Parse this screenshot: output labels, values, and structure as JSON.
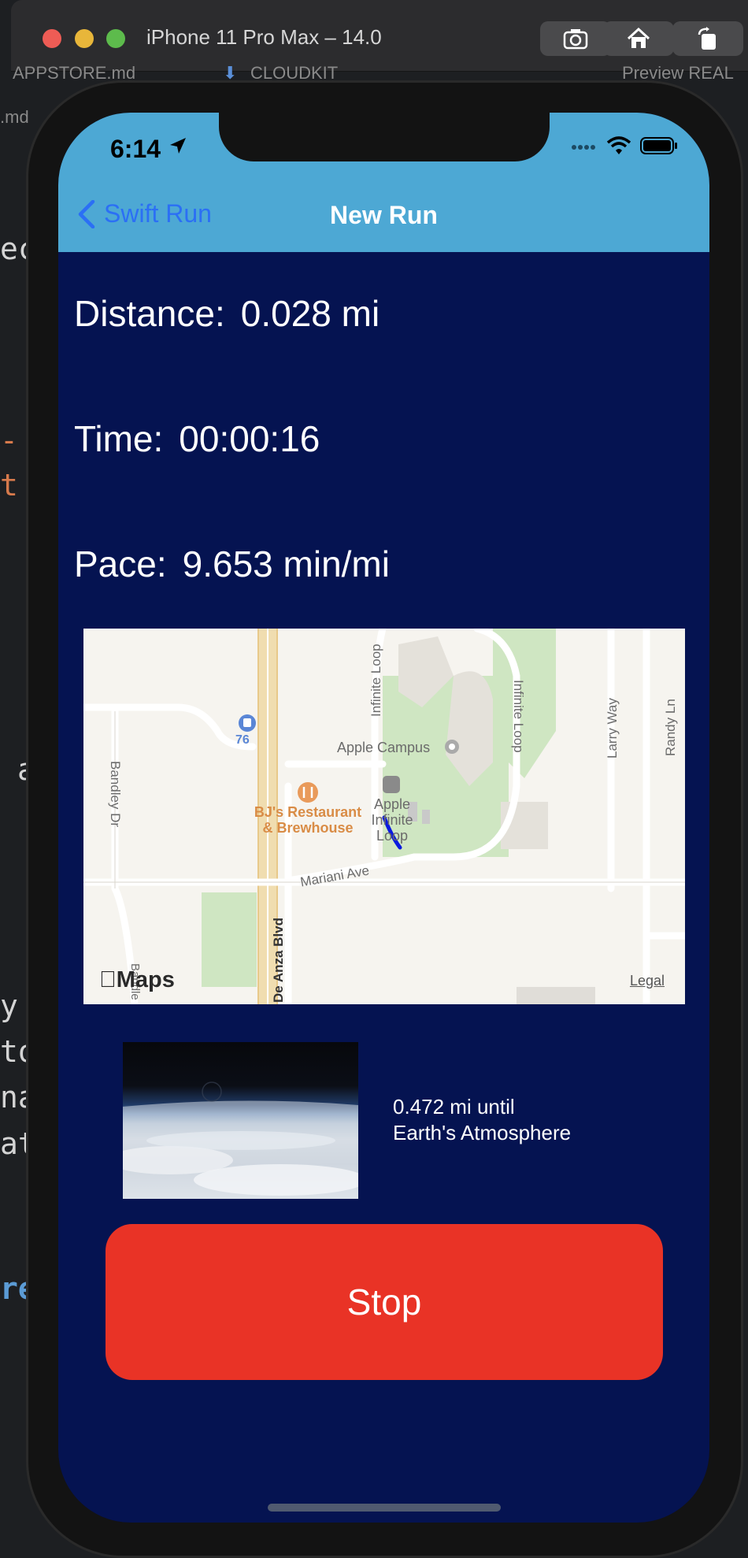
{
  "simulator": {
    "title": "iPhone 11 Pro Max – 14.0",
    "buttons": [
      "screenshot",
      "home",
      "rotate"
    ]
  },
  "editor": {
    "tabs": [
      "APPSTORE.md",
      "CLOUDKIT",
      "Preview REAL"
    ],
    "side_tab": ".md",
    "code_fragments": [
      "ec",
      "-",
      "t",
      "a",
      "y",
      "to",
      "na",
      "at",
      "re"
    ]
  },
  "status_bar": {
    "time": "6:14"
  },
  "nav": {
    "back_label": "Swift Run",
    "title": "New Run"
  },
  "stats": {
    "distance_label": "Distance:",
    "distance_value": "0.028 mi",
    "time_label": "Time:",
    "time_value": "00:00:16",
    "pace_label": "Pace:",
    "pace_value": "9.653 min/mi"
  },
  "map": {
    "labels": {
      "infinite_loop_1": "Infinite Loop",
      "infinite_loop_2": "Infinite Loop",
      "larry_way": "Larry Way",
      "randy_ln": "Randy Ln",
      "apple_campus": "Apple Campus",
      "bandley_dr": "Bandley Dr",
      "bandley_dr_2": "Bandle",
      "de_anza": "De Anza Blvd",
      "mariani": "Mariani Ave",
      "apple_infinite_loop": "Apple Infinite Loop",
      "bjs": "BJ's Restaurant & Brewhouse",
      "gas_number": "76"
    },
    "logo": "Maps",
    "legal": "Legal"
  },
  "atmosphere": {
    "line1": "0.472 mi until",
    "line2": "Earth's Atmosphere"
  },
  "stop_label": "Stop",
  "colors": {
    "navbar": "#4da8d4",
    "background": "#051351",
    "stop": "#e93326",
    "back": "#2b6ff5"
  }
}
